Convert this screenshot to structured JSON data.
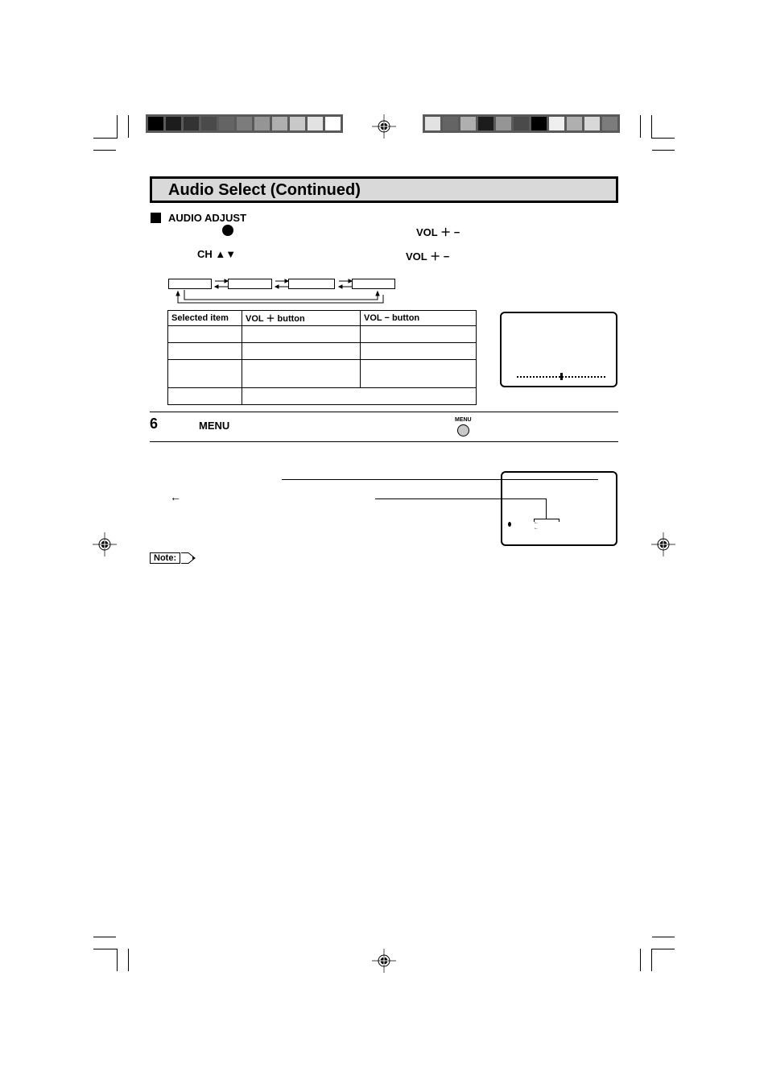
{
  "colorbars": {
    "left": [
      "#000000",
      "#1c1c1c",
      "#333333",
      "#4a4a4a",
      "#646464",
      "#7c7c7c",
      "#959595",
      "#afafaf",
      "#c8c8c8",
      "#e2e2e2",
      "#ffffff"
    ],
    "right": [
      "#e2e2e2",
      "#646464",
      "#afafaf",
      "#1c1c1c",
      "#959595",
      "#4a4a4a",
      "#000000",
      "#efefef",
      "#afafaf",
      "#d8d8d8",
      "#7c7c7c"
    ]
  },
  "page": {
    "title": "Audio Select (Continued)",
    "section_heading": "AUDIO ADJUST",
    "line1_button": "VOL ＋ −",
    "line2_channel": "CH ▲▼",
    "line2_button": "VOL ＋ −"
  },
  "table": {
    "headers": [
      "Selected item",
      "VOL ＋ button",
      "VOL − button"
    ],
    "rows": [
      [
        "",
        "",
        ""
      ],
      [
        "",
        "",
        ""
      ],
      [
        "",
        "",
        ""
      ],
      [
        "",
        ""
      ]
    ]
  },
  "osd_screen": {
    "slider_level_percent": 50
  },
  "step6": {
    "number": "6",
    "label": "MENU",
    "button_caption": "MENU"
  },
  "arrow_symbol": "←",
  "note_label": "Note:"
}
